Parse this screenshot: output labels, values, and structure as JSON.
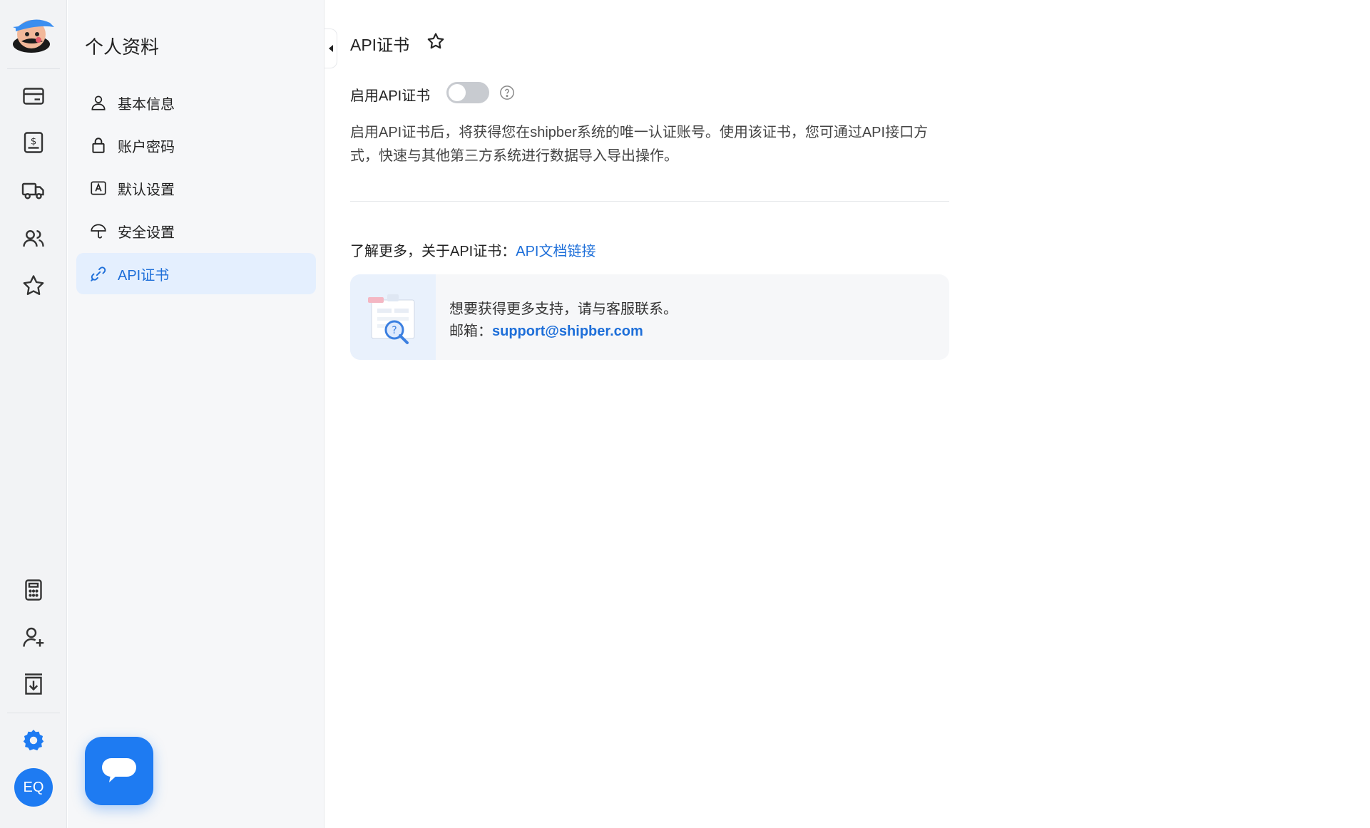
{
  "nav_rail": {
    "logo": "mascot-logo",
    "top_icons": [
      "wallet-icon",
      "dollar-receipt-icon",
      "truck-icon",
      "users-icon",
      "star-icon"
    ],
    "bottom_icons": [
      "calculator-icon",
      "add-user-icon",
      "download-box-icon",
      "gear-icon"
    ],
    "avatar_initials": "EQ",
    "accent_color": "#1e7bf2"
  },
  "menu": {
    "title": "个人资料",
    "items": [
      {
        "label": "基本信息",
        "icon": "user-icon"
      },
      {
        "label": "账户密码",
        "icon": "lock-icon"
      },
      {
        "label": "默认设置",
        "icon": "default-settings-icon"
      },
      {
        "label": "安全设置",
        "icon": "umbrella-icon"
      },
      {
        "label": "API证书",
        "icon": "link-icon",
        "active": true
      }
    ]
  },
  "main": {
    "title": "API证书",
    "toggle": {
      "label": "启用API证书",
      "enabled": false
    },
    "description": "启用API证书后，将获得您在shipber系统的唯一认证账号。使用该证书，您可通过API接口方式，快速与其他第三方系统进行数据导入导出操作。",
    "learn_more": {
      "prefix": "了解更多，关于API证书：",
      "link_text": "API文档链接"
    },
    "support": {
      "line1": "想要获得更多支持，请与客服联系。",
      "email_label": "邮箱：",
      "email": "support@shipber.com"
    }
  }
}
